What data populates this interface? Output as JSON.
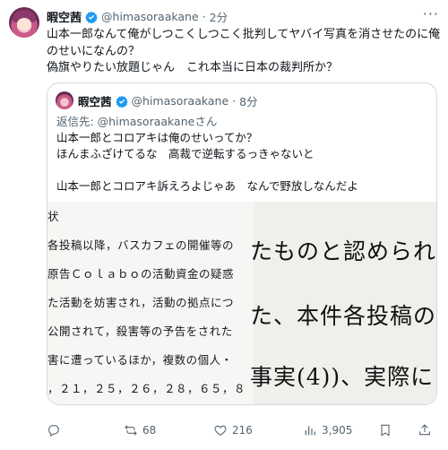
{
  "post": {
    "author_name": "暇空茜",
    "handle": "@himasoraakane",
    "separator": "·",
    "time": "2分",
    "more": "···",
    "text_lines": [
      "山本一郎なんて俺がしつこくしつこく批判してヤバイ写真を消させたのに俺",
      "のせいになんの？",
      "偽旗やりたい放題じゃん　これ本当に日本の裁判所か？"
    ]
  },
  "quote": {
    "author_name": "暇空茜",
    "handle": "@himasoraakane",
    "separator": "·",
    "time": "8分",
    "reply_to": "返信先: @himasoraakaneさん",
    "text_lines": [
      "山本一郎とコロアキは俺のせいってか？",
      "ほんまふざけてるな　高裁で逆転するっきゃないと",
      "",
      "山本一郎とコロアキ訴えろよじゃあ　なんで野放しなんだよ"
    ],
    "image": {
      "left_lines": [
        "状",
        "各投稿以降，バスカフェの開催等の",
        "原告Ｃｏｌａｂｏの活動資金の疑惑",
        "た活動を妨害され，活動の拠点につ",
        "公開されて，殺害等の予告をされた",
        "害に遭っているほか，複数の個人・",
        "，２１，２５，２６，２８，６５，８"
      ],
      "right_lines": [
        "たものと認められ",
        "た、本件各投稿の",
        "事実(4))、実際に"
      ]
    }
  },
  "actions": {
    "reposts": "68",
    "likes": "216",
    "views": "3,905"
  },
  "colors": {
    "verified": "#1d9bf0",
    "secondary_text": "#536471",
    "border": "#cfd9de"
  }
}
